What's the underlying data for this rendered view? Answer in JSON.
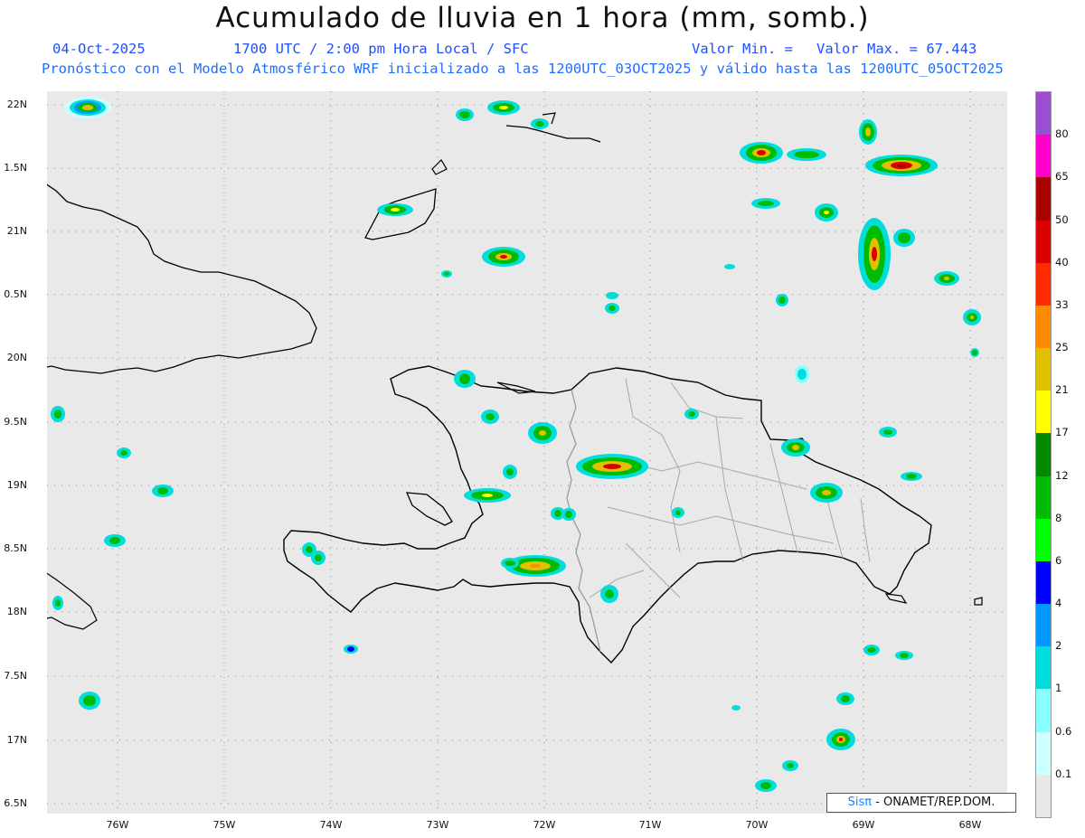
{
  "header": {
    "title": "Acumulado de lluvia en 1 hora (mm, somb.)",
    "date": "04-Oct-2025",
    "time": "1700 UTC / 2:00 pm Hora Local / SFC",
    "valmin": "Valor Min. =",
    "valmax": "Valor Max. = 67.443",
    "model_line": "Pronóstico con el Modelo Atmosférico WRF inicializado a las 1200UTC_03OCT2025 y válido hasta las  1200UTC_05OCT2025"
  },
  "axes": {
    "lat_labels": [
      "22N",
      "1.5N",
      "21N",
      "0.5N",
      "20N",
      "9.5N",
      "19N",
      "8.5N",
      "18N",
      "7.5N",
      "17N",
      "6.5N"
    ],
    "lon_labels": [
      "76W",
      "75W",
      "74W",
      "73W",
      "72W",
      "71W",
      "70W",
      "69W",
      "68W"
    ]
  },
  "legend": {
    "labels": [
      "80",
      "65",
      "50",
      "40",
      "33",
      "25",
      "21",
      "17",
      "12",
      "8",
      "6",
      "4",
      "2",
      "1",
      "0.6",
      "0.1"
    ],
    "colors": [
      "#9b4fd0",
      "#ff00cc",
      "#aa0000",
      "#dd0000",
      "#ff2a00",
      "#ff8c00",
      "#e0c000",
      "#ffff00",
      "#008800",
      "#00bb00",
      "#00ff00",
      "#0000ff",
      "#0099ff",
      "#00dddd",
      "#88ffff",
      "#ccffff",
      "#e8e8e8"
    ]
  },
  "credit": {
    "sis": "Sisπ",
    "rest": " - ONAMET/REP.DOM."
  }
}
